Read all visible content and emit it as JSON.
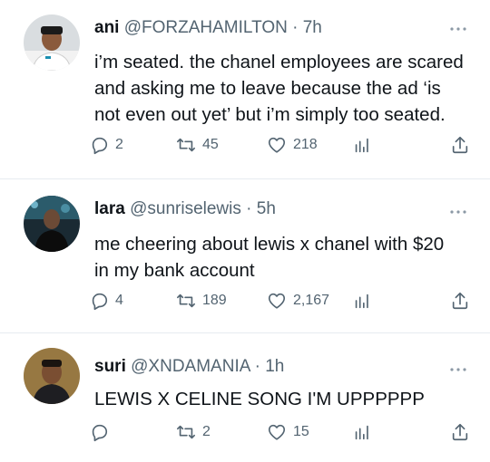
{
  "tweets": [
    {
      "name": "ani",
      "handle": "@FORZAHAMILTON",
      "separator": "·",
      "time": "7h",
      "text_lines": [
        "i’m seated. the chanel employees are scared",
        "and asking me to leave because the ad ‘is",
        "not even out yet’ but i’m simply too seated."
      ],
      "replies": "2",
      "retweets": "45",
      "likes": "218"
    },
    {
      "name": "lara",
      "handle": "@sunriselewis",
      "separator": "·",
      "time": "5h",
      "text_lines": [
        "me cheering about lewis x chanel with $20",
        "in my bank account"
      ],
      "replies": "4",
      "retweets": "189",
      "likes": "2,167"
    },
    {
      "name": "suri",
      "handle": "@XNDAMANIA",
      "separator": "·",
      "time": "1h",
      "text_lines": [
        "LEWIS X CELINE SONG I'M UPPPPPP"
      ],
      "replies": "",
      "retweets": "2",
      "likes": "15"
    }
  ],
  "icons": {
    "more": "more-horizontal-icon",
    "reply": "reply-icon",
    "retweet": "retweet-icon",
    "like": "heart-icon",
    "analytics": "analytics-icon",
    "share": "share-icon"
  },
  "colors": {
    "text": "#0f1419",
    "secondary": "#536471",
    "divider": "#e6ecf0"
  }
}
